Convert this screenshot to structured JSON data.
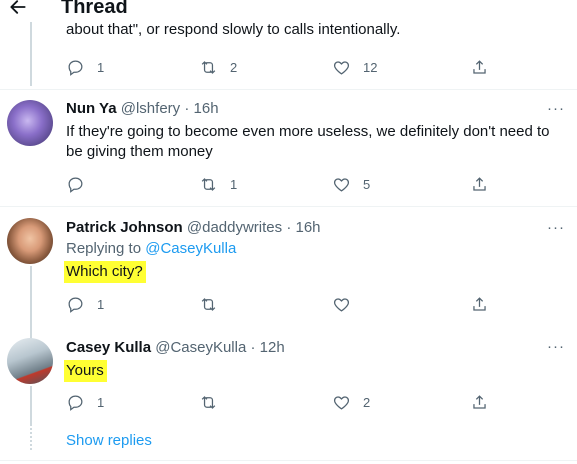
{
  "header": {
    "title": "Thread"
  },
  "prev_tweet": {
    "text": "about that\", or respond slowly to calls intentionally.",
    "reply_count": "1",
    "retweet_count": "2",
    "like_count": "12"
  },
  "tweets": [
    {
      "name": "Nun Ya",
      "handle": "@lshfery",
      "time": "16h",
      "text": "If they're going to become even more useless, we definitely don't need to be giving them money",
      "reply_count": "",
      "retweet_count": "1",
      "like_count": "5"
    },
    {
      "name": "Patrick Johnson",
      "handle": "@daddywrites",
      "time": "16h",
      "replying_prefix": "Replying to ",
      "replying_to": "@CaseyKulla",
      "text": "Which city?",
      "reply_count": "1",
      "retweet_count": "",
      "like_count": ""
    },
    {
      "name": "Casey Kulla",
      "handle": "@CaseyKulla",
      "time": "12h",
      "text": "Yours",
      "reply_count": "1",
      "retweet_count": "",
      "like_count": "2"
    }
  ],
  "separator": "·",
  "more_label": "···",
  "show_replies": "Show replies",
  "colors": {
    "highlight": "#ffff33",
    "link": "#1d9bf0",
    "muted": "#536471"
  }
}
